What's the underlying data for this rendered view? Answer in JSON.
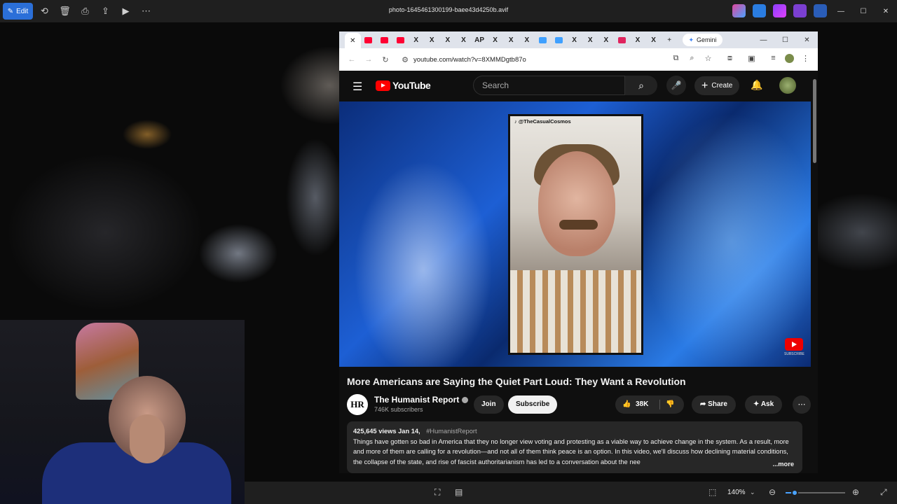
{
  "photos_app": {
    "edit_label": "Edit",
    "file_name": "photo-1645461300199-baee43d4250b.avif",
    "zoom_level": "140%",
    "zoom_fraction": 0.15
  },
  "browser": {
    "gemini_label": "Gemini",
    "url": "youtube.com/watch?v=8XMMDgtb87o",
    "tabs": [
      {
        "color": "#ff0033"
      },
      {
        "color": "#ff0033"
      },
      {
        "color": "#ff0033"
      },
      {
        "glyph": "X"
      },
      {
        "glyph": "X"
      },
      {
        "glyph": "X"
      },
      {
        "glyph": "X"
      },
      {
        "glyph": "AP"
      },
      {
        "glyph": "X"
      },
      {
        "glyph": "X"
      },
      {
        "glyph": "X"
      },
      {
        "color": "#3fa0ff"
      },
      {
        "color": "#3fa0ff"
      },
      {
        "glyph": "X"
      },
      {
        "glyph": "X"
      },
      {
        "glyph": "X"
      },
      {
        "color": "#e0245e"
      },
      {
        "glyph": "X"
      },
      {
        "glyph": "X"
      }
    ]
  },
  "youtube": {
    "logo_text": "YouTube",
    "search_placeholder": "Search",
    "create_label": "Create",
    "video_overlay_handle": "@TheCasualCosmos",
    "subscribe_watermark": "SUBSCRIBE",
    "video_title": "More Americans are Saying the Quiet Part Loud: They Want a Revolution",
    "channel": {
      "name": "The Humanist Report",
      "subscribers": "746K subscribers",
      "avatar_text": "HR"
    },
    "buttons": {
      "join": "Join",
      "subscribe": "Subscribe",
      "likes": "38K",
      "share": "Share",
      "ask": "Ask"
    },
    "description": {
      "stats": "425,645 views  Jan 14,",
      "hashtag": "#HumanistReport",
      "text": "Things have gotten so bad in America that they no longer view voting and protesting as a viable way to achieve change in the system. As a result, more and more of them are calling for a revolution—and not all of them think peace is an option. In this video, we'll discuss how declining material conditions, the collapse of the state, and rise of fascist authoritarianism has led to a conversation about the nee",
      "more_label": "...more"
    }
  }
}
